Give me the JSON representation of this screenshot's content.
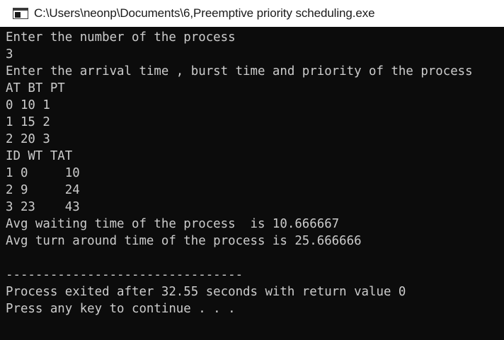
{
  "window": {
    "title": "C:\\Users\\neonp\\Documents\\6,Preemptive priority scheduling.exe",
    "icon": "console-window-icon"
  },
  "console": {
    "lines": [
      "Enter the number of the process",
      "3",
      "Enter the arrival time , burst time and priority of the process",
      "AT BT PT",
      "0 10 1",
      "1 15 2",
      "2 20 3",
      "ID WT TAT",
      "1 0     10",
      "2 9     24",
      "3 23    43",
      "Avg waiting time of the process  is 10.666667",
      "Avg turn around time of the process is 25.666666",
      "",
      "--------------------------------",
      "Process exited after 32.55 seconds with return value 0",
      "Press any key to continue . . ."
    ]
  },
  "colors": {
    "background": "#0c0c0c",
    "text": "#cccccc",
    "titlebar": "#ffffff"
  }
}
